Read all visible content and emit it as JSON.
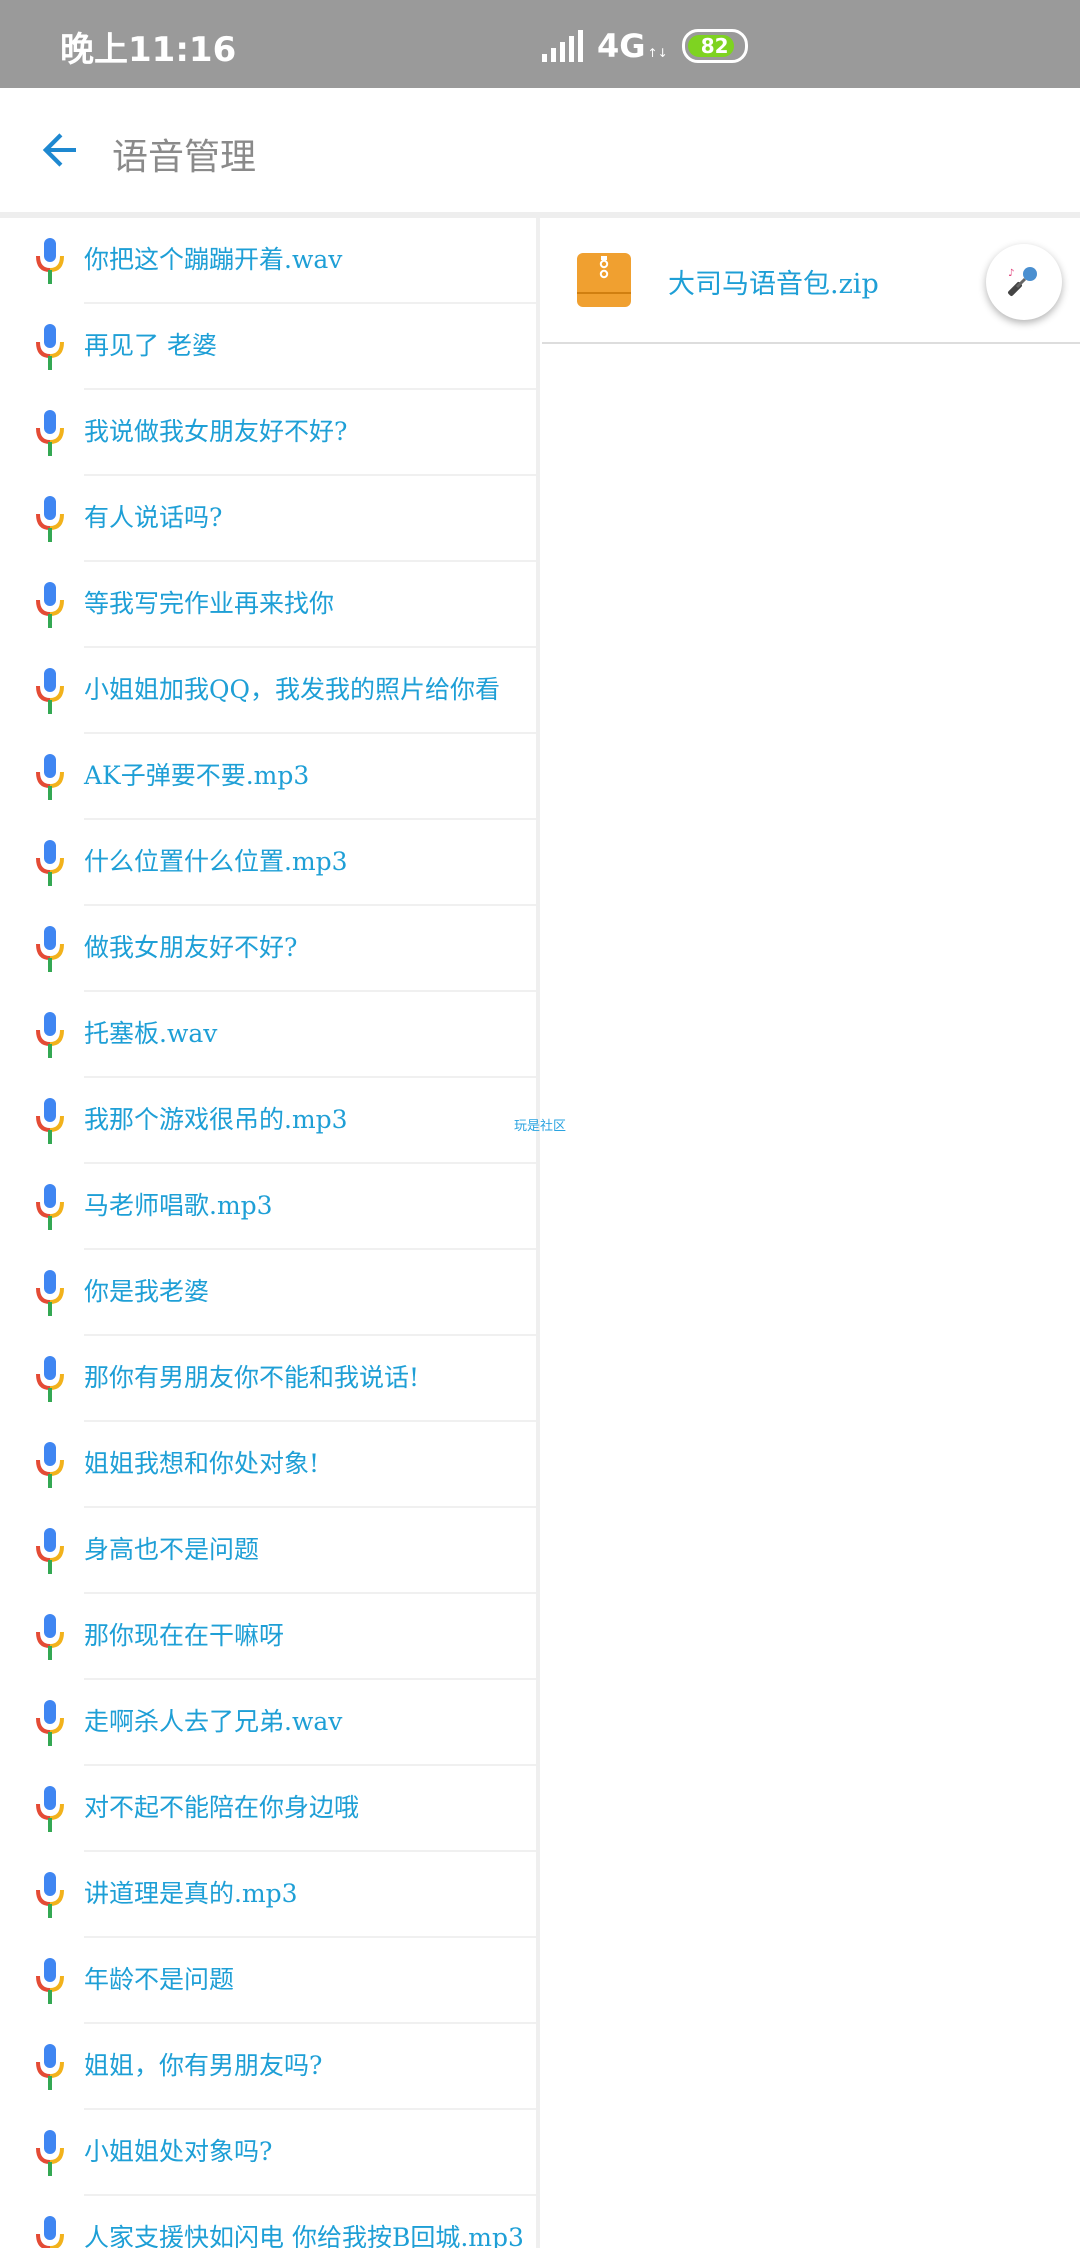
{
  "status_bar": {
    "time": "晚上11:16",
    "network": "4G",
    "battery": "82"
  },
  "app_bar": {
    "title": "语音管理",
    "back_icon": "arrow-left-icon"
  },
  "voice_list": [
    "你把这个蹦蹦开着.wav",
    "再见了 老婆",
    "我说做我女朋友好不好?",
    "有人说话吗?",
    "等我写完作业再来找你",
    "小姐姐加我QQ，我发我的照片给你看",
    "AK子弹要不要.mp3",
    "什么位置什么位置.mp3",
    "做我女朋友好不好?",
    "托塞板.wav",
    "我那个游戏很吊的.mp3",
    "马老师唱歌.mp3",
    "你是我老婆",
    "那你有男朋友你不能和我说话!",
    "姐姐我想和你处对象!",
    "身高也不是问题",
    "那你现在在干嘛呀",
    "走啊杀人去了兄弟.wav",
    "对不起不能陪在你身边哦",
    "讲道理是真的.mp3",
    "年龄不是问题",
    "姐姐，你有男朋友吗?",
    "小姐姐处对象吗?",
    "人家支援快如闪电 你给我按B回城.mp3"
  ],
  "right_pane": {
    "zip_file": "大司马语音包.zip"
  },
  "watermark": "玩是社区",
  "colors": {
    "accent": "#1e9fd6",
    "status_bar_bg": "#9a9a9a",
    "battery_green": "#7ed321",
    "zip_orange": "#f0a030"
  }
}
